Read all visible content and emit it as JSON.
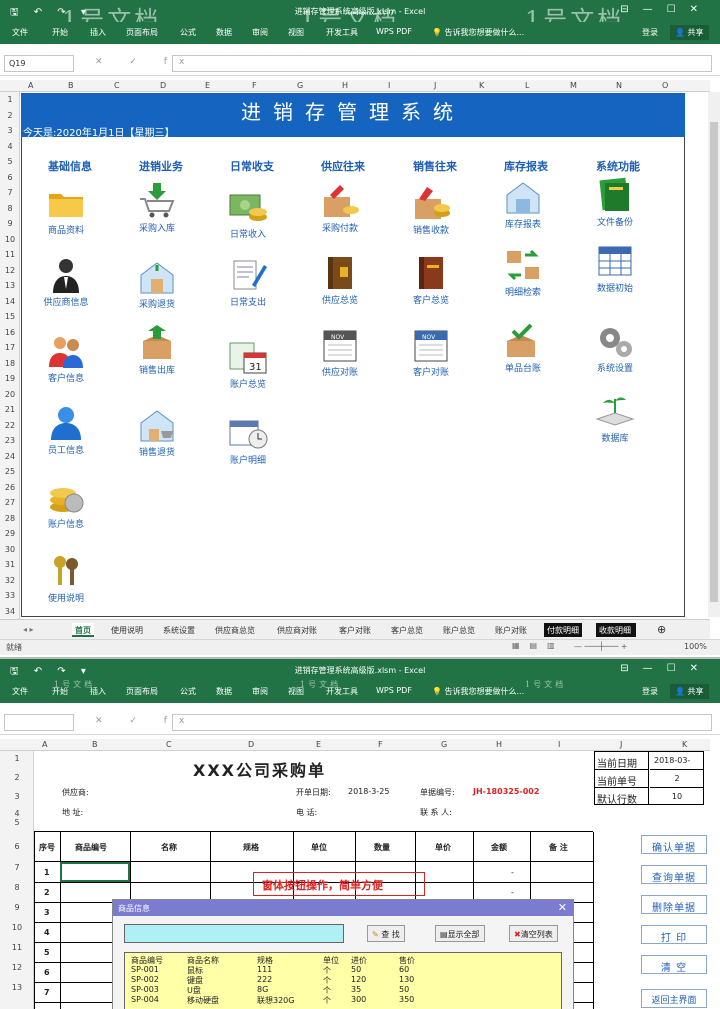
{
  "w1": {
    "qa": "🖫 ↶ ↷ ▾",
    "title": "进销存管理系统高级版.xlsm - Excel",
    "watermark": "1号文档",
    "menu": [
      "文件",
      "开始",
      "插入",
      "页面布局",
      "公式",
      "数据",
      "审阅",
      "视图",
      "开发工具",
      "WPS PDF",
      "告诉我您想要做什么..."
    ],
    "login": "登录",
    "share": "共享",
    "namebox": "Q19",
    "fx": "✕ ✓ fx",
    "cols": [
      "A",
      "B",
      "C",
      "D",
      "E",
      "F",
      "G",
      "H",
      "I",
      "J",
      "K",
      "L",
      "M",
      "N",
      "O"
    ],
    "rows": [
      "1",
      "2",
      "3",
      "4",
      "5",
      "6",
      "7",
      "8",
      "9",
      "10",
      "11",
      "12",
      "13",
      "14",
      "15",
      "16",
      "17",
      "18",
      "19",
      "20",
      "21",
      "22",
      "23",
      "24",
      "25",
      "26",
      "27",
      "28",
      "29",
      "30",
      "31",
      "32",
      "33",
      "34"
    ],
    "banner": "进销存管理系统",
    "today": "今天是:2020年1月1日【星期三】",
    "categories": [
      "基础信息",
      "进销业务",
      "日常收支",
      "供应往来",
      "销售往来",
      "库存报表",
      "系统功能"
    ],
    "items": [
      [
        "商品资料",
        "供应商信息",
        "客户信息",
        "员工信息",
        "账户信息",
        "使用说明"
      ],
      [
        "采购入库",
        "采购退货",
        "销售出库",
        "销售退货"
      ],
      [
        "日常收入",
        "日常支出",
        "账户总览",
        "账户明细"
      ],
      [
        "采购付款",
        "供应总览",
        "供应对账"
      ],
      [
        "销售收款",
        "客户总览",
        "客户对账"
      ],
      [
        "库存报表",
        "明细检索",
        "单品台账"
      ],
      [
        "文件备份",
        "数据初始",
        "系统设置",
        "数据库"
      ]
    ],
    "tabs": [
      "首页",
      "使用说明",
      "系统设置",
      "供应商总览",
      "供应商对账",
      "客户对账",
      "客户总览",
      "账户总览",
      "账户对账",
      "付款明细",
      "收款明细"
    ],
    "status_left": "就绪",
    "zoom": "100%"
  },
  "w2": {
    "title": "进销存管理系统高级版.xlsm - Excel",
    "cols": [
      "A",
      "B",
      "C",
      "D",
      "E",
      "F",
      "G",
      "H",
      "I",
      "J",
      "K"
    ],
    "rows": [
      "1",
      "2",
      "3",
      "4",
      "5",
      "6",
      "7",
      "8",
      "9",
      "10",
      "11",
      "12",
      "13"
    ],
    "form_title": "XXX公司采购单",
    "supplier": "供应商:",
    "address": "地    址:",
    "open_date_label": "开单日期:",
    "open_date": "2018-3-25",
    "doc_no_label": "单据编号:",
    "doc_no": "JH-180325-002",
    "phone": "电    话:",
    "contact": "联  系  人:",
    "side": [
      [
        "当前日期",
        "2018-03-"
      ],
      [
        "当前单号",
        "2"
      ],
      [
        "默认行数",
        "10"
      ]
    ],
    "headers": [
      "序号",
      "商品编号",
      "名称",
      "规格",
      "单位",
      "数量",
      "单价",
      "金额",
      "备  注"
    ],
    "seq": [
      "1",
      "2",
      "3",
      "4",
      "5",
      "6",
      "7"
    ],
    "dash": "-",
    "callout": "窗体按钮操作，简单方便",
    "buttons": [
      "确认单据",
      "查询单据",
      "删除单据",
      "打    印",
      "清    空",
      "返回主界面"
    ],
    "dialog": {
      "title": "商品信息",
      "close": "✕",
      "search": "查 找",
      "show_all": "显示全部",
      "clear": "清空列表",
      "cols": [
        "商品编号",
        "商品名称",
        "规格",
        "单位",
        "进价",
        "售价"
      ],
      "rows": [
        [
          "SP-001",
          "鼠标",
          "111",
          "个",
          "50",
          "60"
        ],
        [
          "SP-002",
          "键盘",
          "222",
          "个",
          "120",
          "130"
        ],
        [
          "SP-003",
          "U盘",
          "8G",
          "个",
          "35",
          "50"
        ],
        [
          "SP-004",
          "移动硬盘",
          "联想320G",
          "个",
          "300",
          "350"
        ]
      ]
    }
  }
}
